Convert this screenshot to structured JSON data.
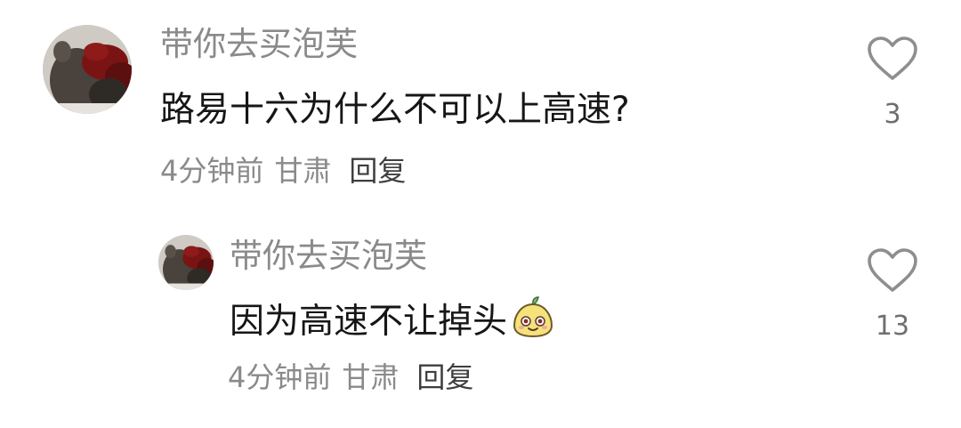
{
  "comments": [
    {
      "avatar": "avatar-icon",
      "username": "带你去买泡芙",
      "text": "路易十六为什么不可以上高速?",
      "time": "4分钟前",
      "location": "甘肃",
      "reply_label": "回复",
      "like_count": "3",
      "like_icon": "heart-outline-icon"
    },
    {
      "avatar": "avatar-icon",
      "username": "带你去买泡芙",
      "text": "因为高速不让掉头",
      "emoji": "yellow-character-emoji",
      "time": "4分钟前",
      "location": "甘肃",
      "reply_label": "回复",
      "like_count": "13",
      "like_icon": "heart-outline-icon"
    }
  ],
  "colors": {
    "text_primary": "#161616",
    "text_secondary": "#8a8a8a",
    "icon_outline": "#8e8e8e",
    "emoji_yellow": "#f5e27a"
  }
}
